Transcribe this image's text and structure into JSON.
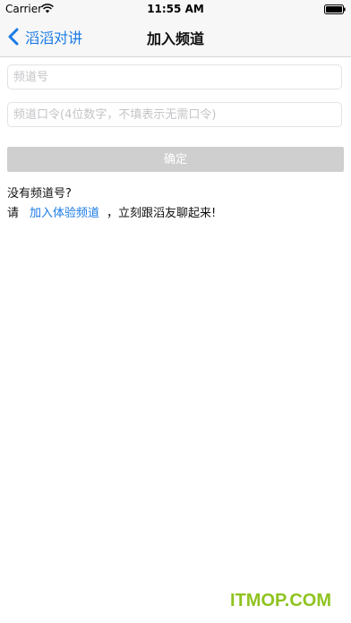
{
  "status_bar": {
    "carrier": "Carrier",
    "time": "11:55 AM"
  },
  "nav": {
    "back_label": "滔滔对讲",
    "title": "加入频道"
  },
  "form": {
    "channel_placeholder": "频道号",
    "password_placeholder": "频道口令(4位数字，不填表示无需口令)",
    "confirm_label": "确定"
  },
  "hint": {
    "title": "没有频道号?",
    "prefix": "请",
    "link_label": "加入体验频道",
    "suffix": "，立刻跟滔友聊起来!"
  },
  "watermark": "ITMOP.COM",
  "colors": {
    "accent": "#1a7ae6",
    "button_disabled": "#cfcfcf",
    "watermark": "#8fc31f"
  },
  "icons": {
    "wifi": "wifi-icon",
    "battery": "battery-icon",
    "back": "chevron-left-icon"
  }
}
